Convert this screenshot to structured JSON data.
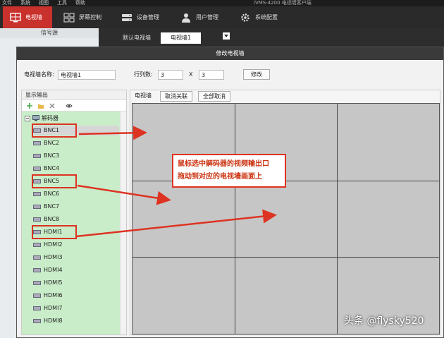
{
  "menubar": {
    "items": [
      "文件",
      "系统",
      "视图",
      "工具",
      "帮助"
    ],
    "app_title": "iVMS-4200 电视墙客户端"
  },
  "toolbar": {
    "items": [
      {
        "label": "电视墙",
        "icon": "tv-wall-icon",
        "active": true
      },
      {
        "label": "屏幕控制",
        "icon": "screen-grid-icon"
      },
      {
        "label": "设备管理",
        "icon": "device-icon"
      },
      {
        "label": "用户管理",
        "icon": "user-icon"
      },
      {
        "label": "系统配置",
        "icon": "gear-icon"
      }
    ]
  },
  "background": {
    "left_header": "信号源",
    "tabs": [
      "默认电视墙",
      "电视墙1"
    ]
  },
  "dialog": {
    "title": "修改电视墙",
    "name_label": "电视墙名称:",
    "name_value": "电视墙1",
    "rows_cols_label": "行列数:",
    "rows": "3",
    "x_label": "X",
    "cols": "3",
    "modify_button": "修改"
  },
  "tree": {
    "title": "显示输出",
    "root_label": "解码器",
    "items": [
      "BNC1",
      "BNC2",
      "BNC3",
      "BNC4",
      "BNC5",
      "BNC6",
      "BNC7",
      "BNC8",
      "HDMI1",
      "HDMI2",
      "HDMI3",
      "HDMI4",
      "HDMI5",
      "HDMI6",
      "HDMI7",
      "HDMI8"
    ]
  },
  "wall": {
    "label": "电视墙",
    "unlink_button": "取消关联",
    "cancel_all_button": "全部取消",
    "rows": 3,
    "cols": 3
  },
  "annotation": {
    "line1": "鼠标选中解码器的视频输出口",
    "line2": "拖动到对应的电视墙画面上"
  },
  "watermark": "头条 @flysky520",
  "colors": {
    "accent_red": "#c9312c",
    "annotation_red": "#d32f2f",
    "tree_bg": "#c9edc9"
  }
}
